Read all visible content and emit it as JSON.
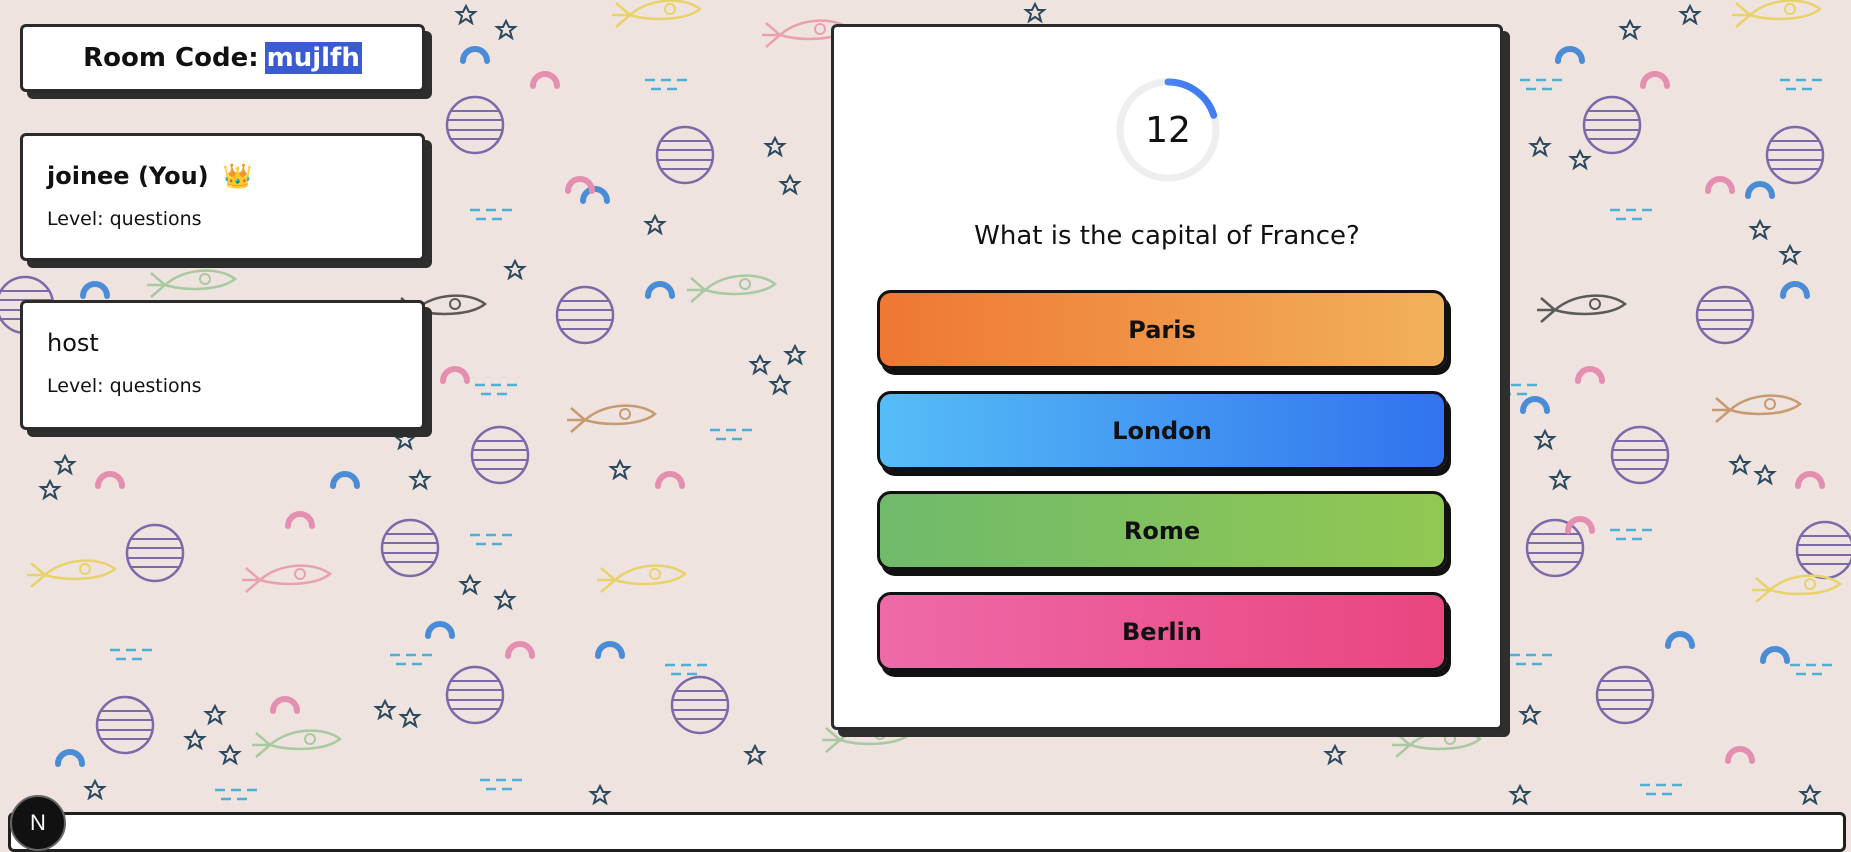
{
  "room": {
    "label": "Room Code:",
    "code": "mujlfh"
  },
  "players": [
    {
      "name": "joinee (You)",
      "crown": "👑",
      "level": "Level: questions"
    },
    {
      "name": "host",
      "level": "Level: questions"
    }
  ],
  "quiz": {
    "timer": "12",
    "timer_progress": 0.2,
    "question": "What is the capital of France?",
    "answers": [
      "Paris",
      "London",
      "Rome",
      "Berlin"
    ]
  },
  "badge": {
    "letter": "N"
  },
  "colors": {
    "background": "#efe3e0",
    "highlight": "#3b5bd3",
    "answer_orange": "#ef7733",
    "answer_blue": "#3173ee",
    "answer_green": "#6fba6b",
    "answer_pink": "#e94580"
  },
  "icons": {
    "crown": "crown-icon",
    "timer": "timer-ring-icon",
    "badge": "n-logo-icon"
  }
}
